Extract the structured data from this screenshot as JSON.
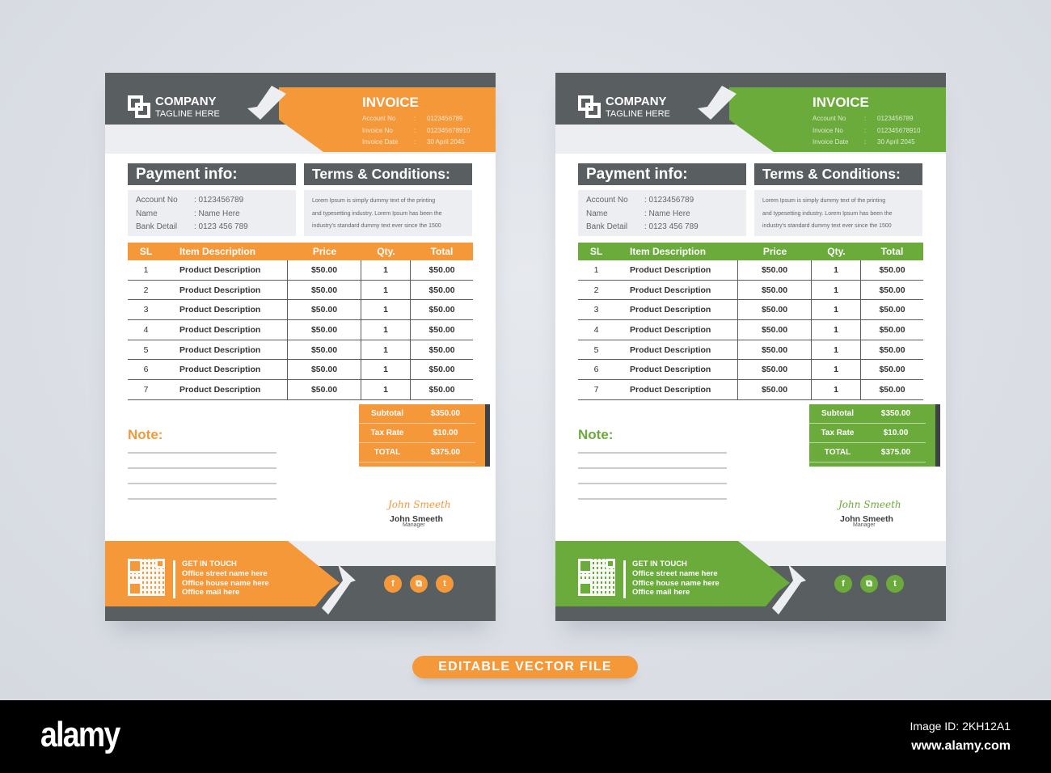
{
  "invoices": [
    {
      "theme": "orange",
      "accent": "#f5983a",
      "header": {
        "company": "COMPANY",
        "tagline": "TAGLINE HERE",
        "title": "INVOICE",
        "meta": [
          {
            "label": "Account No",
            "sep": ":",
            "value": "0123456789"
          },
          {
            "label": "Invoice No",
            "sep": ":",
            "value": "012345678910"
          },
          {
            "label": "Invoice Date",
            "sep": ":",
            "value": "30 April 2045"
          }
        ]
      },
      "payment": {
        "title": "Payment info:",
        "rows": [
          {
            "label": "Account No",
            "value": ": 0123456789"
          },
          {
            "label": "Name",
            "value": ": Name Here"
          },
          {
            "label": "Bank Detail",
            "value": ": 0123 456 789"
          }
        ]
      },
      "terms": {
        "title": "Terms & Conditions:",
        "lines": [
          "Lorem Ipsum is simply dummy text of the printing",
          "and typesetting industry. Lorem Ipsum has been the",
          "industry's standard dummy text ever since the 1500"
        ]
      },
      "table": {
        "headers": {
          "sl": "SL",
          "desc": "Item Description",
          "price": "Price",
          "qty": "Qty.",
          "total": "Total"
        },
        "rows": [
          {
            "sl": "1",
            "desc": "Product Description",
            "price": "$50.00",
            "qty": "1",
            "total": "$50.00"
          },
          {
            "sl": "2",
            "desc": "Product Description",
            "price": "$50.00",
            "qty": "1",
            "total": "$50.00"
          },
          {
            "sl": "3",
            "desc": "Product Description",
            "price": "$50.00",
            "qty": "1",
            "total": "$50.00"
          },
          {
            "sl": "4",
            "desc": "Product Description",
            "price": "$50.00",
            "qty": "1",
            "total": "$50.00"
          },
          {
            "sl": "5",
            "desc": "Product Description",
            "price": "$50.00",
            "qty": "1",
            "total": "$50.00"
          },
          {
            "sl": "6",
            "desc": "Product Description",
            "price": "$50.00",
            "qty": "1",
            "total": "$50.00"
          },
          {
            "sl": "7",
            "desc": "Product Description",
            "price": "$50.00",
            "qty": "1",
            "total": "$50.00"
          }
        ]
      },
      "totals": [
        {
          "label": "Subtotal",
          "value": "$350.00"
        },
        {
          "label": "Tax Rate",
          "value": "$10.00"
        },
        {
          "label": "TOTAL",
          "value": "$375.00"
        }
      ],
      "note_label": "Note:",
      "signature": {
        "script": "John Smeeth",
        "name": "John Smeeth",
        "role": "Manager"
      },
      "footer": {
        "contact": [
          "GET IN TOUCH",
          "Office street name here",
          "Office house name here",
          "Office mail here"
        ],
        "social": [
          {
            "icon": "facebook-icon",
            "glyph": "f"
          },
          {
            "icon": "instagram-icon",
            "glyph": "⧉"
          },
          {
            "icon": "tumblr-icon",
            "glyph": "t"
          }
        ]
      }
    },
    {
      "theme": "green",
      "accent": "#6aab3b",
      "header": {
        "company": "COMPANY",
        "tagline": "TAGLINE HERE",
        "title": "INVOICE",
        "meta": [
          {
            "label": "Account No",
            "sep": ":",
            "value": "0123456789"
          },
          {
            "label": "Invoice No",
            "sep": ":",
            "value": "012345678910"
          },
          {
            "label": "Invoice Date",
            "sep": ":",
            "value": "30 April 2045"
          }
        ]
      },
      "payment": {
        "title": "Payment info:",
        "rows": [
          {
            "label": "Account No",
            "value": ": 0123456789"
          },
          {
            "label": "Name",
            "value": ": Name Here"
          },
          {
            "label": "Bank Detail",
            "value": ": 0123 456 789"
          }
        ]
      },
      "terms": {
        "title": "Terms & Conditions:",
        "lines": [
          "Lorem Ipsum is simply dummy text of the printing",
          "and typesetting industry. Lorem Ipsum has been the",
          "industry's standard dummy text ever since the 1500"
        ]
      },
      "table": {
        "headers": {
          "sl": "SL",
          "desc": "Item Description",
          "price": "Price",
          "qty": "Qty.",
          "total": "Total"
        },
        "rows": [
          {
            "sl": "1",
            "desc": "Product Description",
            "price": "$50.00",
            "qty": "1",
            "total": "$50.00"
          },
          {
            "sl": "2",
            "desc": "Product Description",
            "price": "$50.00",
            "qty": "1",
            "total": "$50.00"
          },
          {
            "sl": "3",
            "desc": "Product Description",
            "price": "$50.00",
            "qty": "1",
            "total": "$50.00"
          },
          {
            "sl": "4",
            "desc": "Product Description",
            "price": "$50.00",
            "qty": "1",
            "total": "$50.00"
          },
          {
            "sl": "5",
            "desc": "Product Description",
            "price": "$50.00",
            "qty": "1",
            "total": "$50.00"
          },
          {
            "sl": "6",
            "desc": "Product Description",
            "price": "$50.00",
            "qty": "1",
            "total": "$50.00"
          },
          {
            "sl": "7",
            "desc": "Product Description",
            "price": "$50.00",
            "qty": "1",
            "total": "$50.00"
          }
        ]
      },
      "totals": [
        {
          "label": "Subtotal",
          "value": "$350.00"
        },
        {
          "label": "Tax Rate",
          "value": "$10.00"
        },
        {
          "label": "TOTAL",
          "value": "$375.00"
        }
      ],
      "note_label": "Note:",
      "signature": {
        "script": "John Smeeth",
        "name": "John Smeeth",
        "role": "Manager"
      },
      "footer": {
        "contact": [
          "GET IN TOUCH",
          "Office street name here",
          "Office house name here",
          "Office mail here"
        ],
        "social": [
          {
            "icon": "facebook-icon",
            "glyph": "f"
          },
          {
            "icon": "instagram-icon",
            "glyph": "⧉"
          },
          {
            "icon": "tumblr-icon",
            "glyph": "t"
          }
        ]
      }
    }
  ],
  "cta_label": "EDITABLE VECTOR FILE",
  "watermark": {
    "logo": "alamy",
    "image_id": "Image ID: 2KH12A1",
    "site": "www.alamy.com"
  }
}
